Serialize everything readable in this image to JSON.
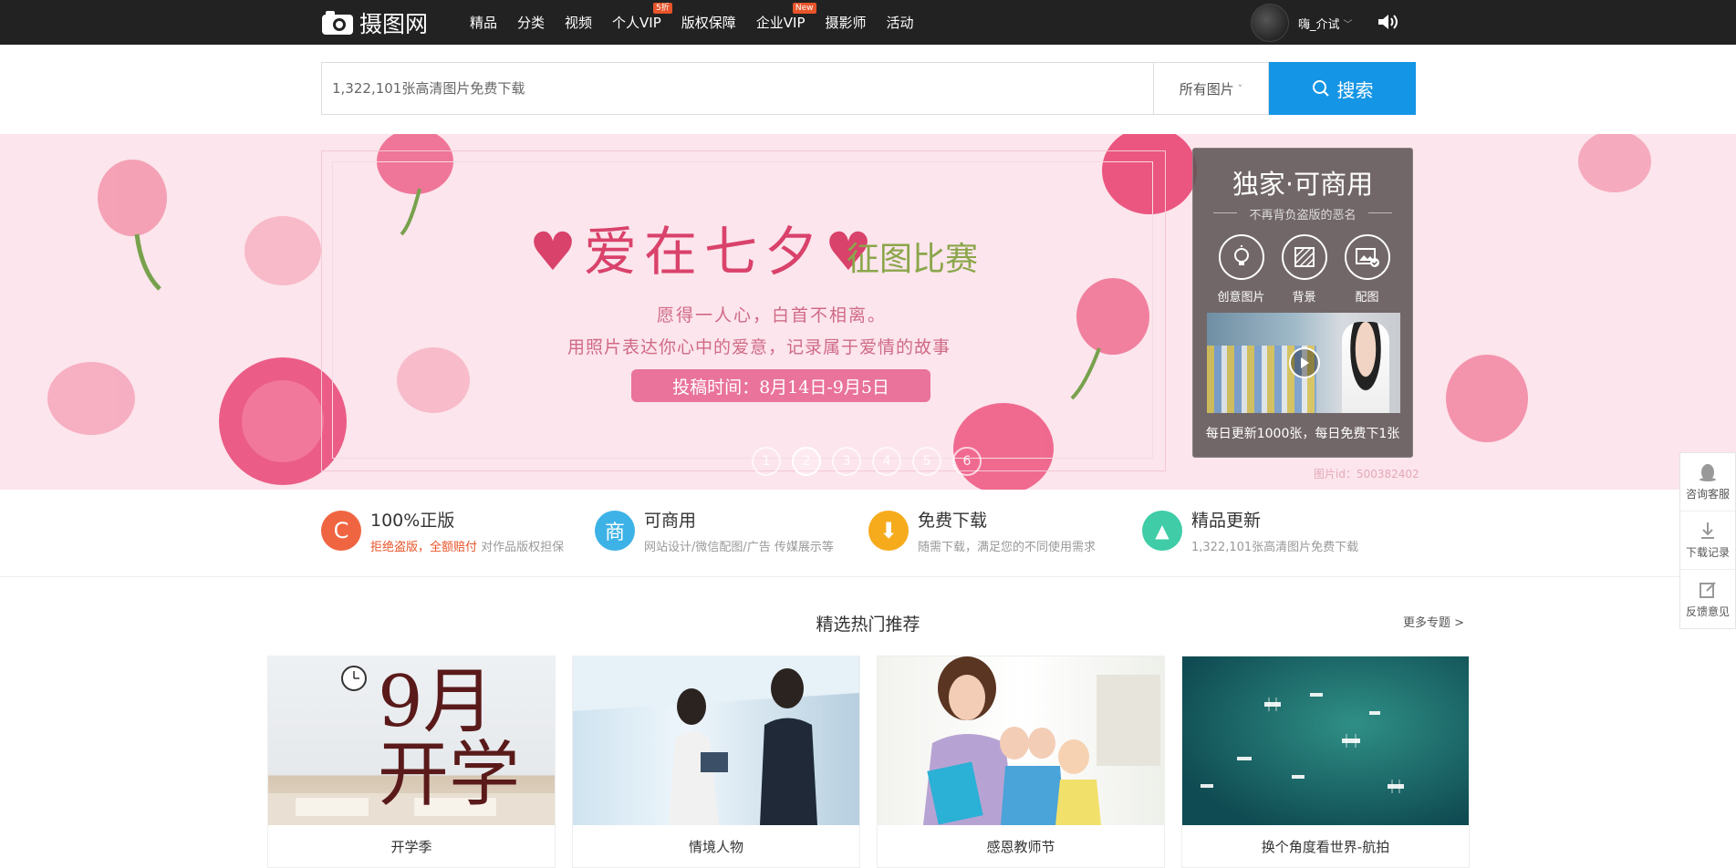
{
  "header": {
    "logo_text": "摄图网",
    "nav": [
      {
        "label": "精品",
        "badge": ""
      },
      {
        "label": "分类",
        "badge": ""
      },
      {
        "label": "视频",
        "badge": ""
      },
      {
        "label": "个人VIP",
        "badge": "5折"
      },
      {
        "label": "版权保障",
        "badge": ""
      },
      {
        "label": "企业VIP",
        "badge": "New"
      },
      {
        "label": "摄影师",
        "badge": ""
      },
      {
        "label": "活动",
        "badge": ""
      }
    ],
    "username": "嗨_介试",
    "caret": "﹀"
  },
  "search": {
    "placeholder": "1,322,101张高清图片免费下载",
    "category": "所有图片",
    "category_caret": "˅",
    "button": "搜索"
  },
  "banner": {
    "title": "♥爱在七夕♥",
    "subtitle": "征图比赛",
    "line1": "愿得一人心，白首不相离。",
    "line2": "用照片表达你心中的爱意，记录属于爱情的故事",
    "deadline": "投稿时间：8月14日-9月5日",
    "dots": [
      "1",
      "2",
      "3",
      "4",
      "5",
      "6"
    ],
    "active_dot": 1,
    "image_id": "图片id：500382402"
  },
  "promo": {
    "title": "独家·可商用",
    "subtitle": "不再背负盗版的恶名",
    "icons": [
      {
        "label": "创意图片",
        "icon": "lightbulb-icon"
      },
      {
        "label": "背景",
        "icon": "texture-icon"
      },
      {
        "label": "配图",
        "icon": "image-check-icon"
      }
    ],
    "caption": "每日更新1000张，每日免费下1张"
  },
  "features": [
    {
      "title": "100%正版",
      "desc_red": "拒绝盗版，全额赔付",
      "desc": " 对作品版权担保",
      "icon": "copyright-icon",
      "glyph": "C",
      "color": "#f06541"
    },
    {
      "title": "可商用",
      "desc_red": "",
      "desc": "网站设计/微信配图/广告 传媒展示等",
      "icon": "commercial-icon",
      "glyph": "商",
      "color": "#3db2e6"
    },
    {
      "title": "免费下载",
      "desc_red": "",
      "desc": "随需下载，满足您的不同使用需求",
      "icon": "download-icon",
      "glyph": "⬇",
      "color": "#f6ab1d"
    },
    {
      "title": "精品更新",
      "desc_red": "",
      "desc": "1,322,101张高清图片免费下载",
      "icon": "picture-icon",
      "glyph": "▲",
      "color": "#3fcca6"
    }
  ],
  "section": {
    "title": "精选热门推荐",
    "more": "更多专题 >"
  },
  "cards": [
    {
      "caption": "开学季",
      "art": "9月开学"
    },
    {
      "caption": "情境人物",
      "art": ""
    },
    {
      "caption": "感恩教师节",
      "art": ""
    },
    {
      "caption": "换个角度看世界-航拍",
      "art": ""
    }
  ],
  "sidebar": [
    {
      "label": "咨询客服",
      "icon": "qq-penguin-icon"
    },
    {
      "label": "下载记录",
      "icon": "download-icon"
    },
    {
      "label": "反馈意见",
      "icon": "edit-icon"
    }
  ],
  "colors": {
    "topbar": "#222222",
    "search_button": "#1595e5",
    "banner_bg": "#fce5ec",
    "accent_red": "#e8542a"
  }
}
